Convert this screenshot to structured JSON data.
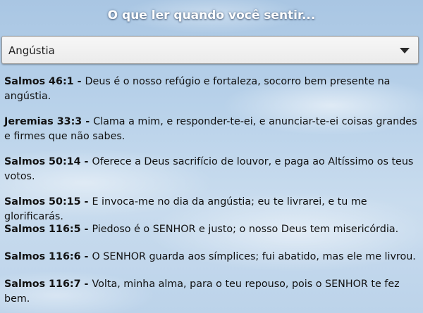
{
  "header": {
    "title": "O que ler quando você sentir..."
  },
  "selector": {
    "selected": "Angústia"
  },
  "verses": [
    {
      "ref": "Salmos 46:1",
      "text": "Deus é o nosso refúgio e fortaleza, socorro bem presente na angústia."
    },
    {
      "ref": "Jeremias 33:3",
      "text": "Clama a mim, e responder-te-ei, e anunciar-te-ei coisas grandes e firmes que não sabes."
    },
    {
      "ref": "Salmos 50:14",
      "text": "Oferece a Deus sacrifício de louvor, e paga ao Altíssimo os teus votos."
    },
    {
      "ref": "Salmos 50:15",
      "text": "E invoca-me no dia da angústia; eu te livrarei, e tu me glorificarás."
    },
    {
      "ref": "Salmos 116:5",
      "text": "Piedoso é o SENHOR e justo; o nosso Deus tem misericórdia."
    },
    {
      "ref": "Salmos 116:6",
      "text": "O SENHOR guarda aos símplices; fui abatido, mas ele me livrou."
    },
    {
      "ref": "Salmos 116:7",
      "text": "Volta, minha alma, para o teu repouso, pois o SENHOR te fez bem."
    }
  ],
  "separator": " - "
}
